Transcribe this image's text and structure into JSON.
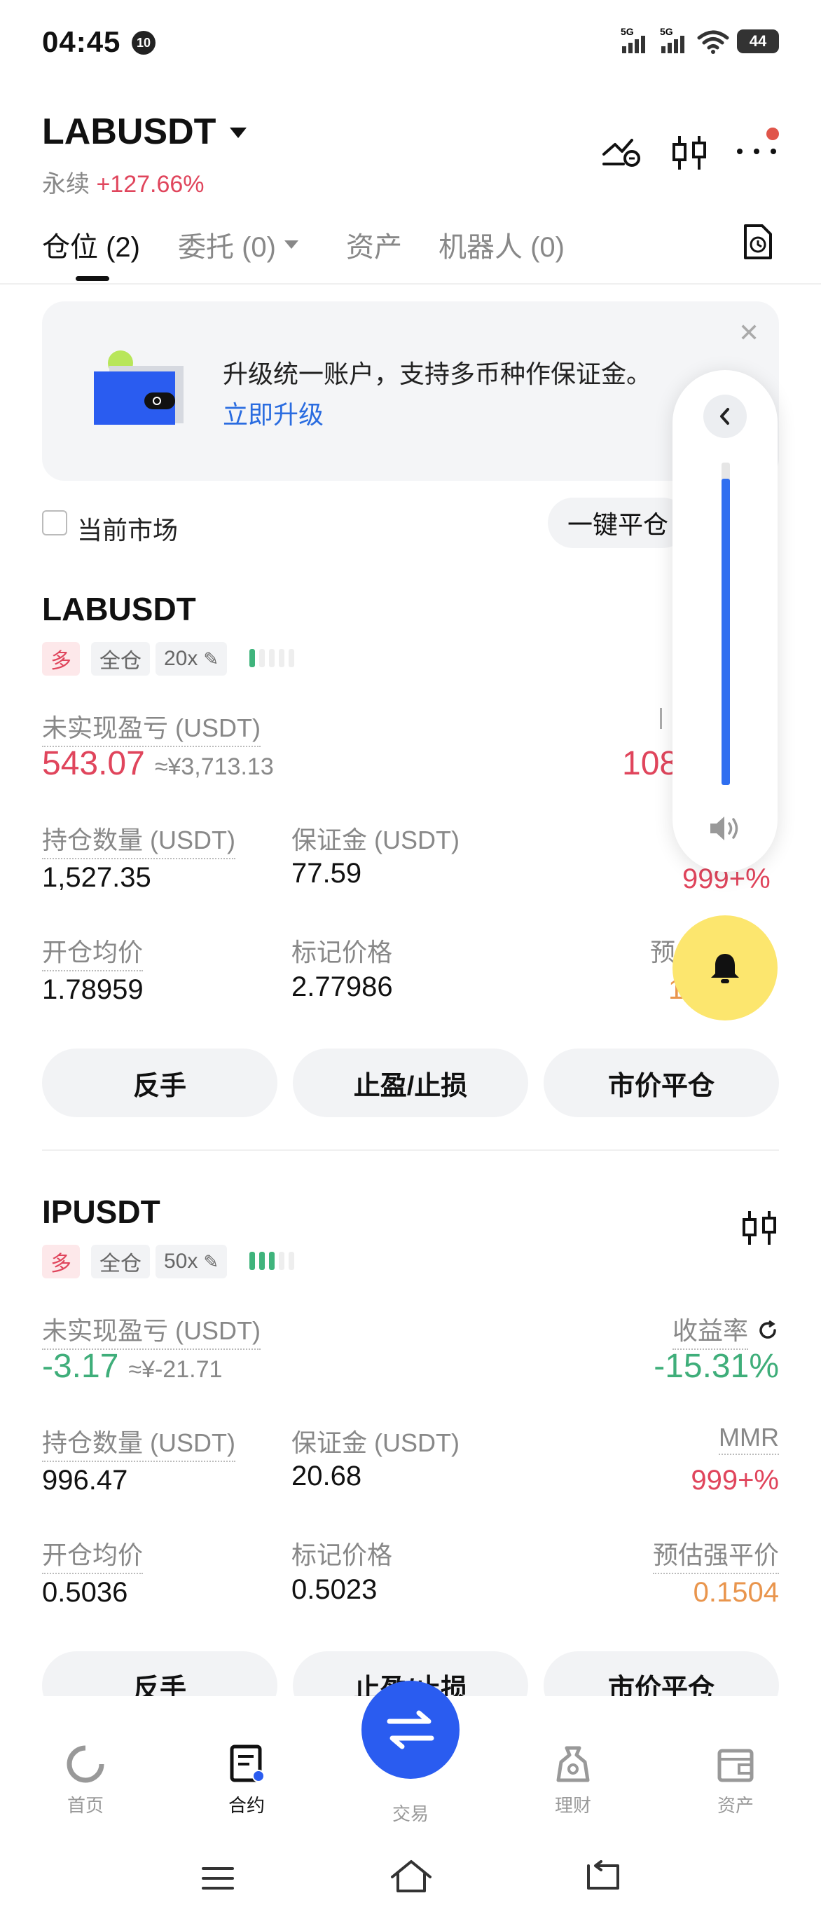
{
  "status_bar": {
    "time": "04:45",
    "notification_badge": "10",
    "signal1": "5G",
    "signal2": "5G",
    "battery": "44"
  },
  "header": {
    "symbol": "LABUSDT",
    "type_label": "永续",
    "change": "+127.66%"
  },
  "tabs": [
    {
      "label": "仓位 (2)"
    },
    {
      "label": "委托 (0)"
    },
    {
      "label": "资产"
    },
    {
      "label": "机器人 (0)"
    }
  ],
  "banner": {
    "text": "升级统一账户，支持多币种作保证金。",
    "link": "立即升级"
  },
  "filter": {
    "checkbox_label": "当前市场",
    "close_all": "一键平仓"
  },
  "positions": [
    {
      "symbol": "LABUSDT",
      "side": "多",
      "margin_mode": "全仓",
      "leverage": "20x",
      "pnl_label": "未实现盈亏 (USDT)",
      "pnl_value": "543.07",
      "pnl_approx": "≈¥3,713.13",
      "roe_value_partial": "108",
      "size_label": "持仓数量 (USDT)",
      "size_value": "1,527.35",
      "margin_label": "保证金 (USDT)",
      "margin_value": "77.59",
      "mmr_value_partial": "999+%",
      "entry_label": "开仓均价",
      "entry_value": "1.78959",
      "mark_label": "标记价格",
      "mark_value": "2.77986",
      "liq_label_partial": "预",
      "liq_value_partial": "1",
      "buttons": [
        "反手",
        "止盈/止损",
        "市价平仓"
      ]
    },
    {
      "symbol": "IPUSDT",
      "side": "多",
      "margin_mode": "全仓",
      "leverage": "50x",
      "pnl_label": "未实现盈亏 (USDT)",
      "pnl_value": "-3.17",
      "pnl_approx": "≈¥-21.71",
      "roe_label": "收益率",
      "roe_value": "-15.31%",
      "size_label": "持仓数量 (USDT)",
      "size_value": "996.47",
      "margin_label": "保证金 (USDT)",
      "margin_value": "20.68",
      "mmr_label": "MMR",
      "mmr_value": "999+%",
      "entry_label": "开仓均价",
      "entry_value": "0.5036",
      "mark_label": "标记价格",
      "mark_value": "0.5023",
      "liq_label": "预估强平价",
      "liq_value": "0.1504",
      "buttons": [
        "反手",
        "止盈/止损",
        "市价平仓"
      ]
    }
  ],
  "volume_panel": {
    "level": 0.95
  },
  "bottom_nav": [
    {
      "label": "首页",
      "icon": "home-icon"
    },
    {
      "label": "合约",
      "icon": "contract-icon",
      "active": true
    },
    {
      "label": "交易",
      "icon": "swap-icon"
    },
    {
      "label": "理财",
      "icon": "finance-icon"
    },
    {
      "label": "资产",
      "icon": "wallet-icon"
    }
  ],
  "colors": {
    "red": "#e0455c",
    "green": "#3fae7a",
    "orange": "#e9954d",
    "blue": "#2a5cf0",
    "yellow": "#fce66e"
  }
}
